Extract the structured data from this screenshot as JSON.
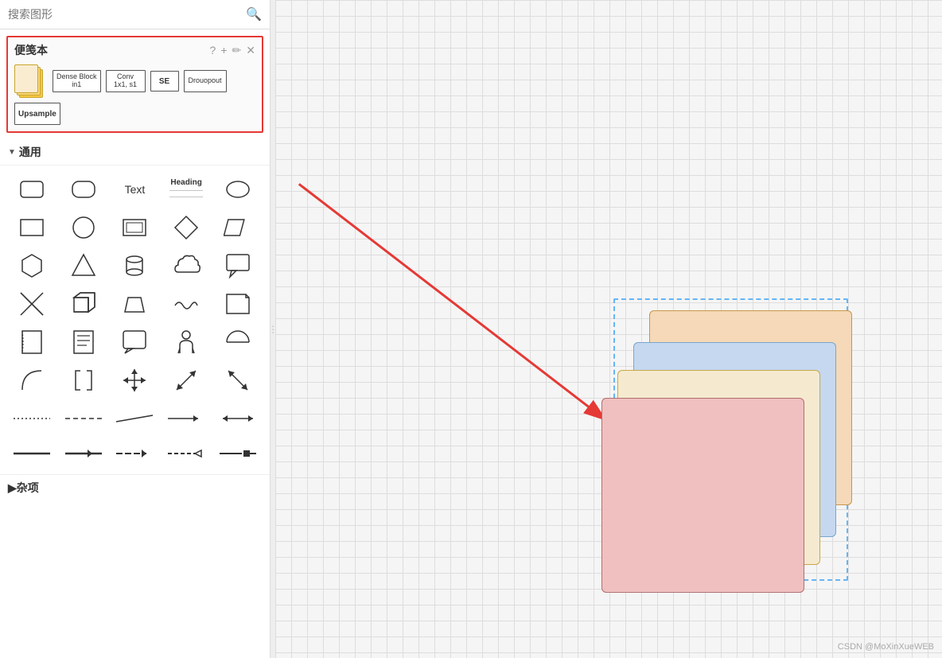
{
  "search": {
    "placeholder": "搜索图形",
    "icon": "🔍"
  },
  "scratchpad": {
    "title": "便笺本",
    "actions": {
      "help": "?",
      "add": "+",
      "edit": "✏",
      "close": "✕"
    },
    "shapes": [
      {
        "id": "stack",
        "type": "stack-icon",
        "label": ""
      },
      {
        "id": "dense-block",
        "type": "box",
        "line1": "Dense Block",
        "line2": "in1"
      },
      {
        "id": "conv",
        "type": "box",
        "line1": "Conv",
        "line2": "1x1, s1"
      },
      {
        "id": "se",
        "type": "box-small",
        "line1": "SE",
        "line2": ""
      },
      {
        "id": "dropout",
        "type": "box",
        "line1": "Drouopout",
        "line2": ""
      },
      {
        "id": "upsample",
        "type": "box",
        "line1": "Upsample",
        "line2": ""
      }
    ]
  },
  "general": {
    "title": "通用",
    "shapes": [
      "rectangle-rounded",
      "rectangle-rounded-2",
      "text",
      "heading",
      "ellipse",
      "rectangle",
      "circle",
      "rectangle-3d",
      "diamond",
      "parallelogram",
      "hexagon",
      "triangle",
      "cylinder",
      "cloud",
      "callout",
      "cross",
      "cube",
      "trapezoid",
      "wave",
      "document",
      "document-fold",
      "note",
      "speech-bubble",
      "person",
      "half-circle",
      "arc",
      "bracket",
      "arrows-lr",
      "arrow-up-down",
      "arrow-diagonal",
      "arrow-2",
      "arrow-3",
      "arrow-4",
      "arrow-5"
    ]
  },
  "misc": {
    "title": "杂项"
  },
  "canvas": {
    "watermark": "CSDN @MoXinXueWEB"
  }
}
